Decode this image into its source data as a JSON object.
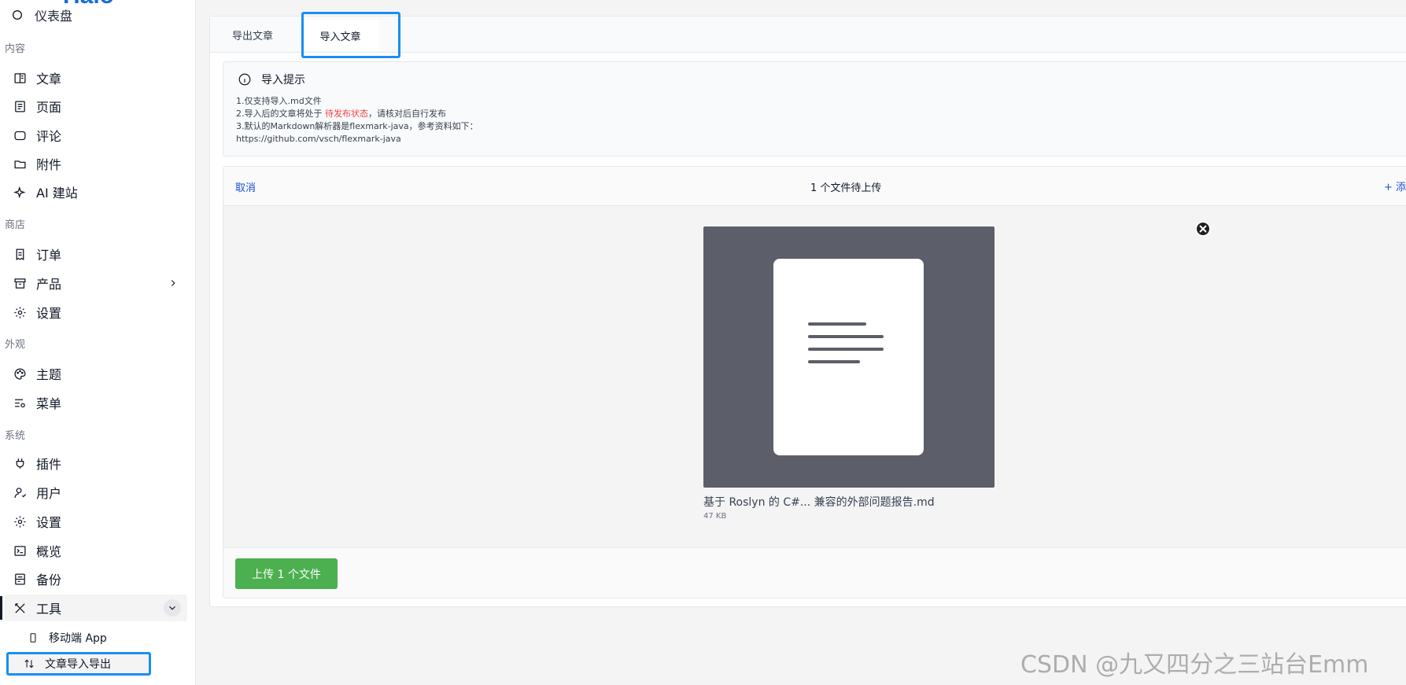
{
  "brand": {
    "text": "Halo"
  },
  "sidebar": {
    "top_item": "仪表盘",
    "groups": {
      "content": "内容",
      "shop": "商店",
      "appearance": "外观",
      "system": "系统"
    },
    "items": {
      "articles": "文章",
      "pages": "页面",
      "comments": "评论",
      "attachments": "附件",
      "ai_site": "AI 建站",
      "orders": "订单",
      "products": "产品",
      "shop_settings": "设置",
      "themes": "主题",
      "menus": "菜单",
      "plugins": "插件",
      "users": "用户",
      "settings": "设置",
      "overview": "概览",
      "backup": "备份",
      "tools": "工具",
      "mobile_app": "移动端 App",
      "import_export": "文章导入导出"
    }
  },
  "tabs": {
    "export": "导出文章",
    "import": "导入文章"
  },
  "notice": {
    "title": "导入提示",
    "line1": "1.仅支持导入.md文件",
    "line2_prefix": "2.导入后的文章将处于 ",
    "line2_highlight": "待发布状态",
    "line2_suffix": "，请核对后自行发布",
    "line3": "3.默认的Markdown解析器是flexmark-java，参考资料如下：",
    "line4": "https://github.com/vsch/flexmark-java"
  },
  "uploader": {
    "cancel": "取消",
    "pending": "1 个文件待上传",
    "add_more": "+ 添",
    "file_name": "基于 Roslyn 的 C#... 兼容的外部问题报告.md",
    "file_size": "47 KB",
    "upload_button": "上传 1 个文件"
  },
  "watermark": "CSDN @九又四分之三站台Emm",
  "colors": {
    "accent": "#1a8ef2",
    "upload_green": "#4caf50",
    "link_blue": "#1d4ed8",
    "highlight_red": "#ef4444"
  }
}
